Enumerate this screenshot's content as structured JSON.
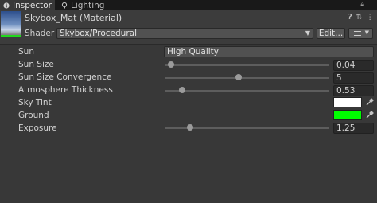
{
  "tabs": {
    "inspector": "Inspector",
    "lighting": "Lighting"
  },
  "material": {
    "title": "Skybox_Mat (Material)",
    "shader_label": "Shader",
    "shader_value": "Skybox/Procedural",
    "edit_label": "Edit..."
  },
  "properties": {
    "sun": {
      "label": "Sun",
      "value": "High Quality"
    },
    "sun_size": {
      "label": "Sun Size",
      "value": "0.04",
      "fraction": 0.04
    },
    "sun_size_convergence": {
      "label": "Sun Size Convergence",
      "value": "5",
      "fraction": 0.45
    },
    "atmosphere_thickness": {
      "label": "Atmosphere Thickness",
      "value": "0.53",
      "fraction": 0.106
    },
    "sky_tint": {
      "label": "Sky Tint",
      "color": "#ffffff"
    },
    "ground": {
      "label": "Ground",
      "color": "#00ff00"
    },
    "exposure": {
      "label": "Exposure",
      "value": "1.25",
      "fraction": 0.156
    }
  },
  "colors": {
    "accent_green": "#21d81d"
  }
}
